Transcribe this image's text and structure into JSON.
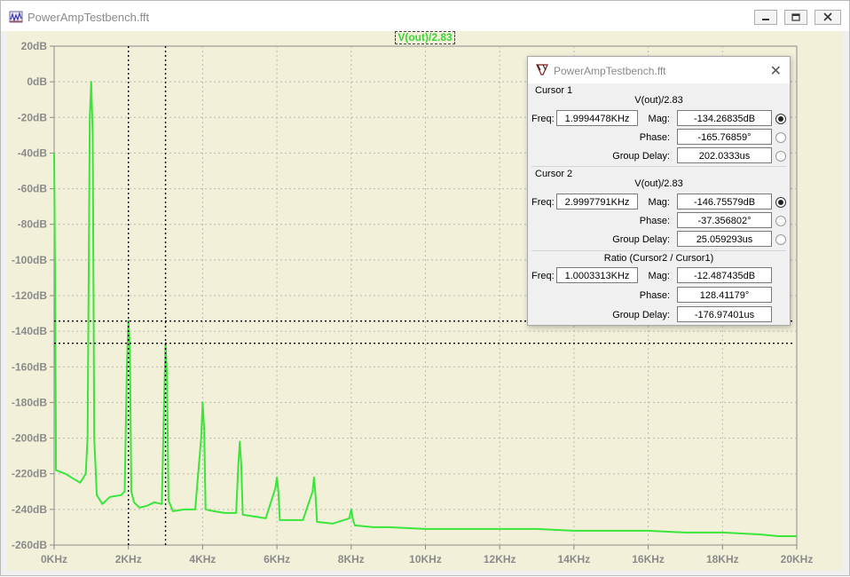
{
  "window": {
    "title": "PowerAmpTestbench.fft"
  },
  "plot": {
    "trace_label": "V(out)/2.83",
    "trace_color": "#39e639",
    "background_color": "#f3f0d9"
  },
  "chart_data": {
    "type": "line",
    "series": [
      {
        "name": "V(out)/2.83",
        "points": [
          [
            0,
            -40
          ],
          [
            30,
            -130
          ],
          [
            50,
            -218
          ],
          [
            300,
            -220
          ],
          [
            700,
            -225
          ],
          [
            850,
            -220
          ],
          [
            900,
            -200
          ],
          [
            960,
            -20
          ],
          [
            1000,
            0
          ],
          [
            1040,
            -30
          ],
          [
            1080,
            -200
          ],
          [
            1150,
            -232
          ],
          [
            1300,
            -237
          ],
          [
            1500,
            -233
          ],
          [
            1800,
            -232
          ],
          [
            1900,
            -230
          ],
          [
            1960,
            -160
          ],
          [
            2000,
            -134
          ],
          [
            2040,
            -150
          ],
          [
            2080,
            -230
          ],
          [
            2150,
            -236
          ],
          [
            2300,
            -239
          ],
          [
            2500,
            -238
          ],
          [
            2700,
            -236
          ],
          [
            2900,
            -237
          ],
          [
            2960,
            -180
          ],
          [
            3000,
            -147
          ],
          [
            3040,
            -165
          ],
          [
            3080,
            -235
          ],
          [
            3200,
            -241
          ],
          [
            3500,
            -240
          ],
          [
            3800,
            -240
          ],
          [
            3960,
            -200
          ],
          [
            4000,
            -180
          ],
          [
            4040,
            -195
          ],
          [
            4080,
            -240
          ],
          [
            4300,
            -241
          ],
          [
            4600,
            -242
          ],
          [
            4900,
            -242
          ],
          [
            4960,
            -215
          ],
          [
            5000,
            -202
          ],
          [
            5040,
            -215
          ],
          [
            5080,
            -243
          ],
          [
            5400,
            -244
          ],
          [
            5700,
            -245
          ],
          [
            5960,
            -228
          ],
          [
            6000,
            -222
          ],
          [
            6040,
            -230
          ],
          [
            6080,
            -246
          ],
          [
            6400,
            -246
          ],
          [
            6700,
            -246
          ],
          [
            6960,
            -230
          ],
          [
            7000,
            -222
          ],
          [
            7040,
            -232
          ],
          [
            7080,
            -247
          ],
          [
            7500,
            -248
          ],
          [
            7950,
            -245
          ],
          [
            8000,
            -240
          ],
          [
            8050,
            -246
          ],
          [
            8100,
            -249
          ],
          [
            8600,
            -250
          ],
          [
            9000,
            -250
          ],
          [
            10000,
            -251
          ],
          [
            11000,
            -251
          ],
          [
            12000,
            -251
          ],
          [
            13000,
            -251
          ],
          [
            14000,
            -252
          ],
          [
            15000,
            -252
          ],
          [
            16000,
            -252
          ],
          [
            17000,
            -253
          ],
          [
            18000,
            -253
          ],
          [
            19000,
            -254
          ],
          [
            19500,
            -255
          ],
          [
            20000,
            -255
          ]
        ]
      }
    ],
    "x_ticks": [
      "0KHz",
      "2KHz",
      "4KHz",
      "6KHz",
      "8KHz",
      "10KHz",
      "12KHz",
      "14KHz",
      "16KHz",
      "18KHz",
      "20KHz"
    ],
    "y_ticks": [
      "20dB",
      "0dB",
      "-20dB",
      "-40dB",
      "-60dB",
      "-80dB",
      "-100dB",
      "-120dB",
      "-140dB",
      "-160dB",
      "-180dB",
      "-200dB",
      "-220dB",
      "-240dB",
      "-260dB"
    ],
    "xlim": [
      0,
      20000
    ],
    "ylim": [
      -260,
      20
    ],
    "grid": true,
    "cursors": [
      {
        "x": 2000,
        "y": -134.26835
      },
      {
        "x": 3000,
        "y": -146.75579
      }
    ]
  },
  "cursor_dialog": {
    "title": "PowerAmpTestbench.fft",
    "cursor1": {
      "heading": "Cursor 1",
      "trace": "V(out)/2.83",
      "freq_label": "Freq:",
      "freq": "1.9994478KHz",
      "mag_label": "Mag:",
      "mag": "-134.26835dB",
      "phase_label": "Phase:",
      "phase": "-165.76859°",
      "gd_label": "Group Delay:",
      "gd": "202.0333us",
      "selected": "mag"
    },
    "cursor2": {
      "heading": "Cursor 2",
      "trace": "V(out)/2.83",
      "freq_label": "Freq:",
      "freq": "2.9997791KHz",
      "mag_label": "Mag:",
      "mag": "-146.75579dB",
      "phase_label": "Phase:",
      "phase": "-37.356802°",
      "gd_label": "Group Delay:",
      "gd": "25.059293us",
      "selected": "mag"
    },
    "ratio": {
      "heading": "Ratio (Cursor2 / Cursor1)",
      "freq_label": "Freq:",
      "freq": "1.0003313KHz",
      "mag_label": "Mag:",
      "mag": "-12.487435dB",
      "phase_label": "Phase:",
      "phase": "128.41179°",
      "gd_label": "Group Delay:",
      "gd": "-176.97401us"
    }
  }
}
